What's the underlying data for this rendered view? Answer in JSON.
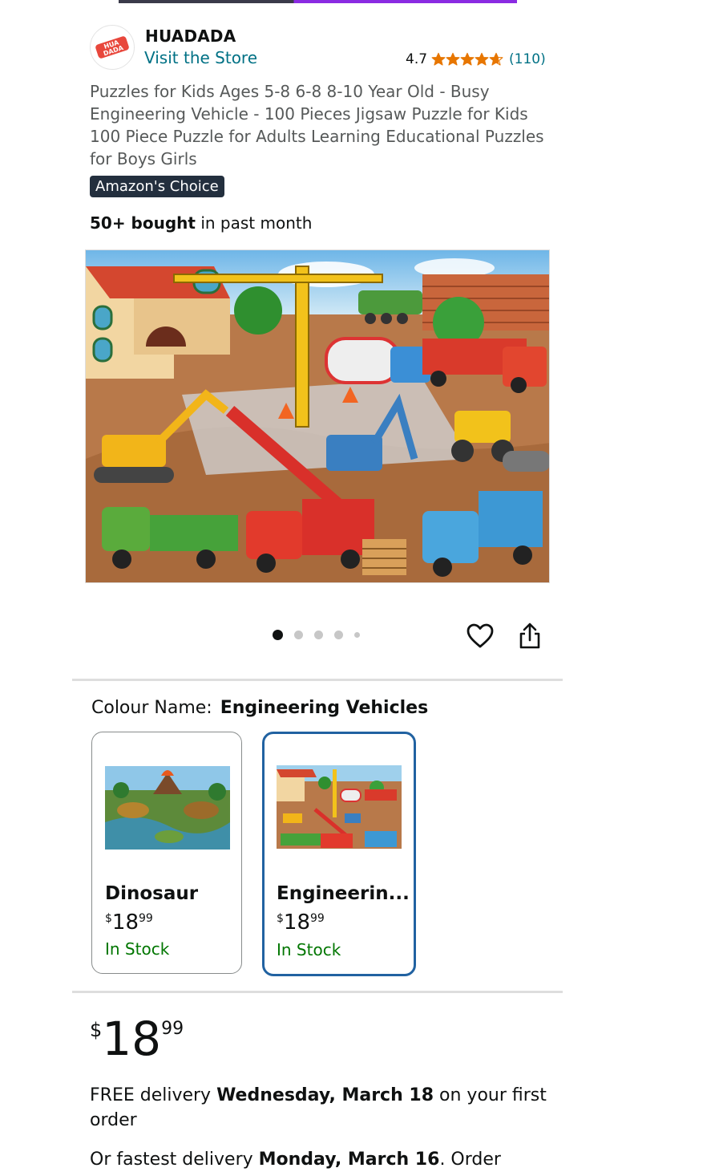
{
  "brand": {
    "name": "HUADADA",
    "logo_text": "HUA DADA",
    "visit_store": "Visit the Store",
    "rating": "4.7",
    "rating_count": "(110)",
    "stars_value": 4.7
  },
  "product": {
    "title": "Puzzles for Kids Ages 5-8 6-8 8-10 Year Old - Busy Engineering Vehicle - 100 Pieces Jigsaw Puzzle for Kids 100 Piece Puzzle for Adults Learning Educational Puzzles for Boys Girls",
    "badge": "Amazon's Choice",
    "bought_bold": "50+ bought",
    "bought_rest": " in past month"
  },
  "carousel": {
    "total": 5,
    "active_index": 0
  },
  "colour": {
    "label": "Colour Name:",
    "selected": "Engineering Vehicles",
    "options": [
      {
        "name": "Dinosaur",
        "currency": "$",
        "whole": "18",
        "fraction": "99",
        "stock": "In Stock",
        "selected": false
      },
      {
        "name": "Engineerin...",
        "currency": "$",
        "whole": "18",
        "fraction": "99",
        "stock": "In Stock",
        "selected": true
      }
    ]
  },
  "price": {
    "currency": "$",
    "whole": "18",
    "fraction": "99"
  },
  "delivery": {
    "prefix": "FREE delivery ",
    "date": "Wednesday, March 18",
    "suffix": " on your first order"
  },
  "fastest": {
    "prefix": "Or fastest delivery ",
    "date": "Monday, March 16",
    "suffix": ". Order"
  },
  "colors": {
    "link": "#007185",
    "badge_bg": "#232f3e",
    "star": "#e77600",
    "in_stock": "#007600",
    "selected_border": "#2162a1"
  }
}
